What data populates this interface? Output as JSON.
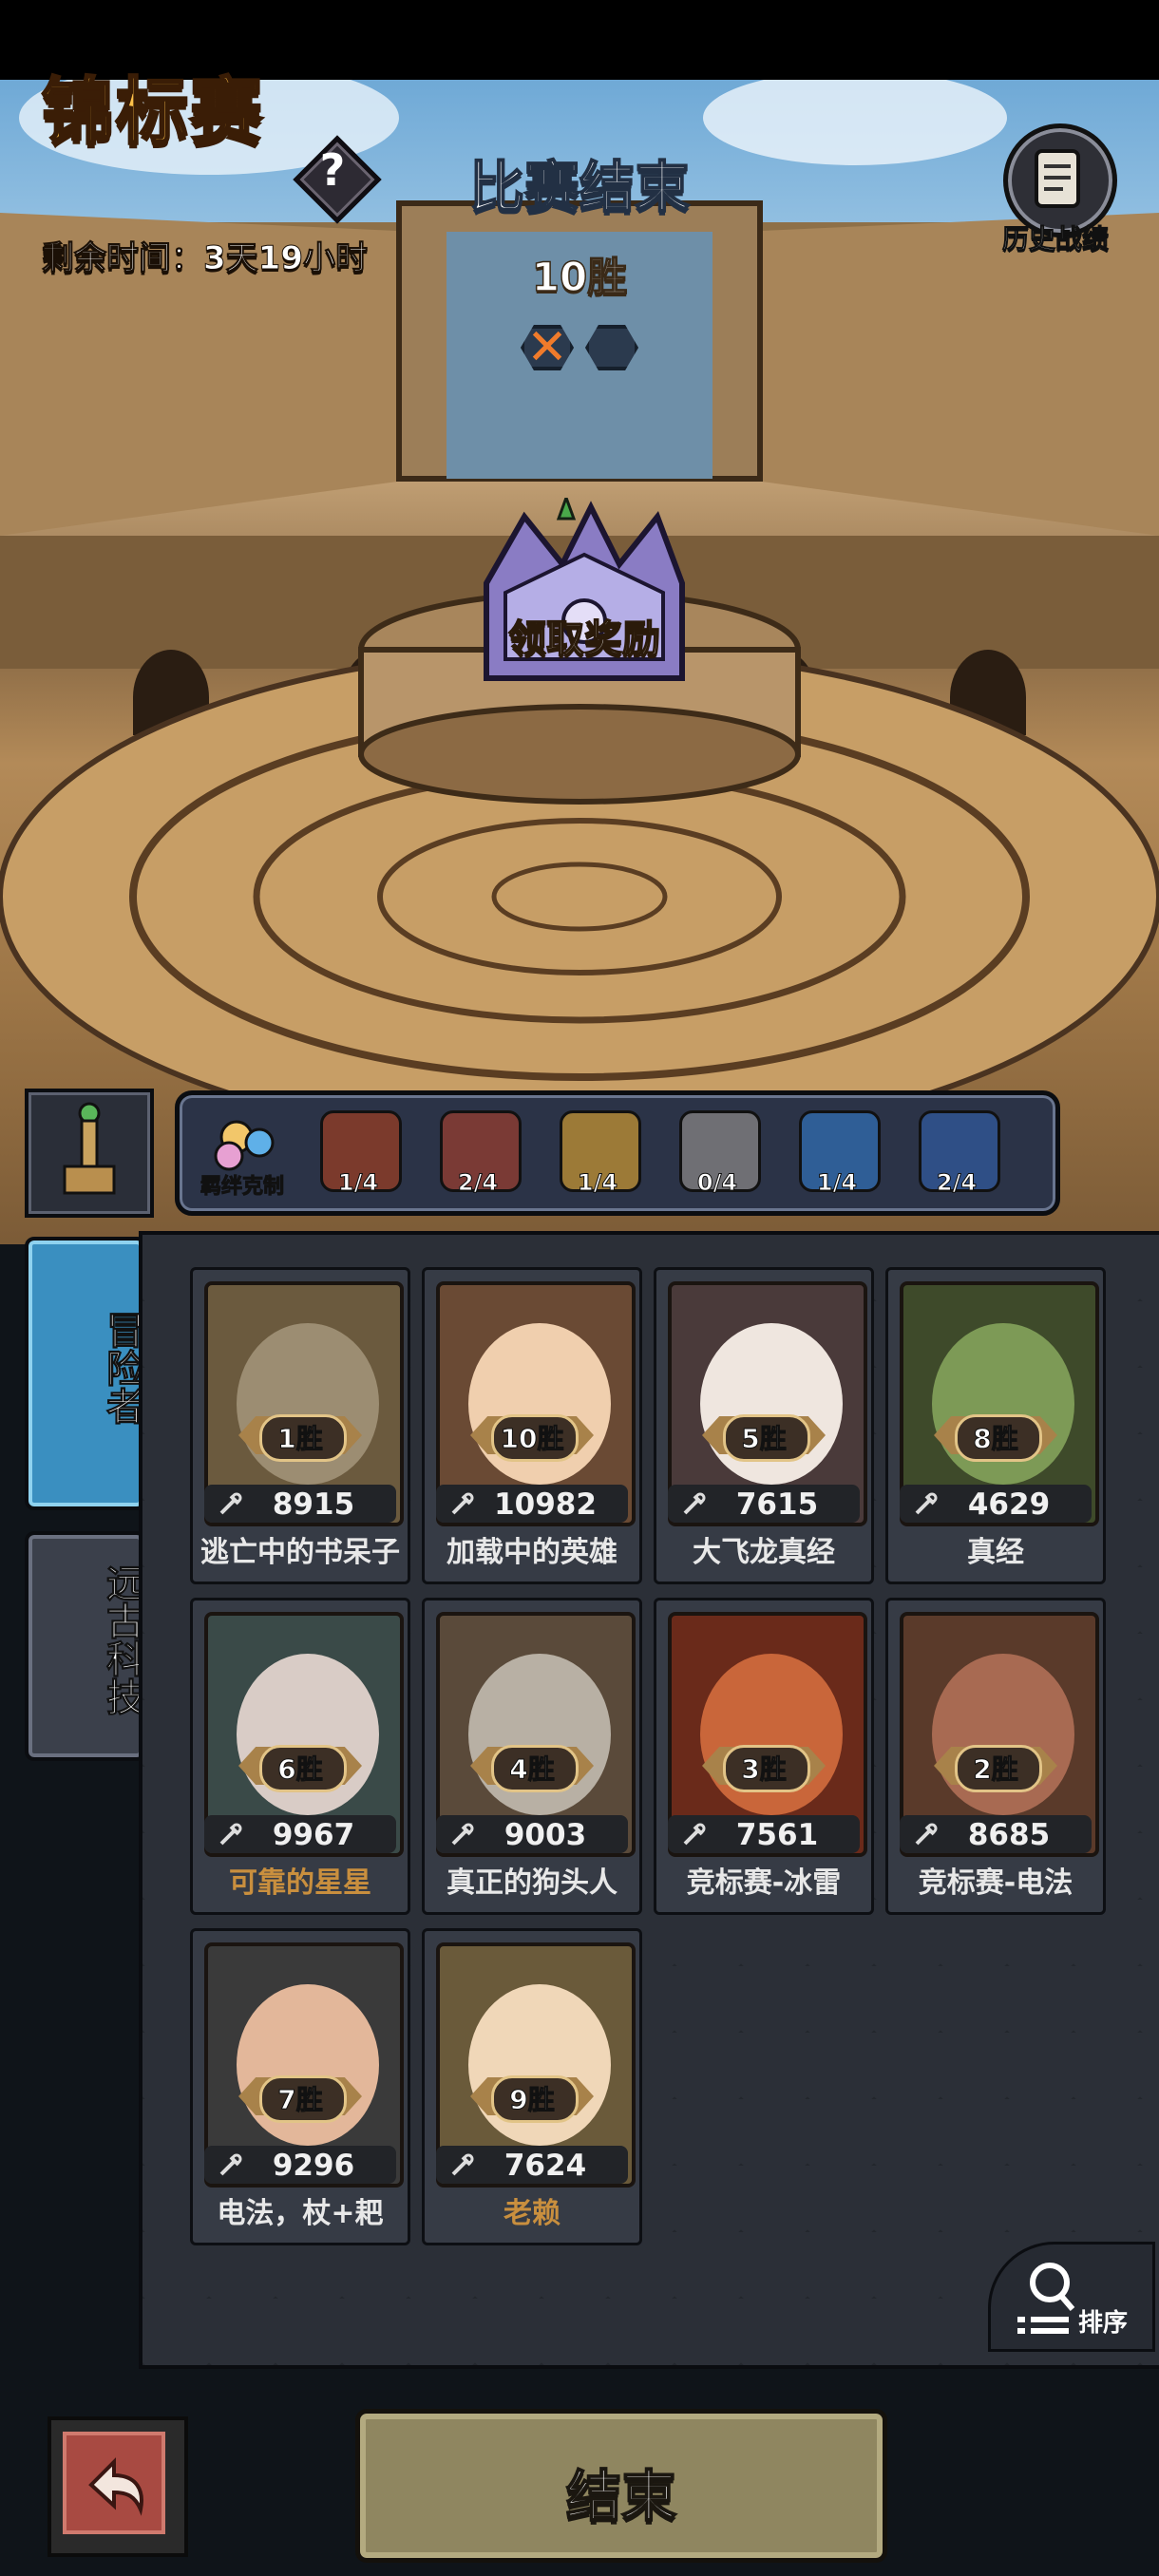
{
  "header": {
    "title": "锦标赛",
    "help_label": "?",
    "remaining_time": "剩余时间：3天19小时",
    "match_status": "比赛结束",
    "wins": "10胜",
    "history_label": "历史战绩"
  },
  "reward": {
    "claim_label": "领取奖励"
  },
  "bonds": {
    "counter_label": "羁绊克制",
    "items": [
      {
        "count": "1/4",
        "color": "#7b3a2c"
      },
      {
        "count": "2/4",
        "color": "#7a3a35"
      },
      {
        "count": "1/4",
        "color": "#9c7a37"
      },
      {
        "count": "0/4",
        "color": "#6f6f74"
      },
      {
        "count": "1/4",
        "color": "#2f5e96"
      },
      {
        "count": "2/4",
        "color": "#2f4f86"
      }
    ]
  },
  "side_tabs": {
    "adventurers": "冒险者",
    "ancient_tech": "远古科技"
  },
  "roster": [
    {
      "wins": "1胜",
      "power": "8915",
      "name": "逃亡中的书呆子",
      "highlight": false,
      "bg": "#6b5a3e",
      "skin": "#9c8d72"
    },
    {
      "wins": "10胜",
      "power": "10982",
      "name": "加载中的英雄",
      "highlight": false,
      "bg": "#6a4a34",
      "skin": "#f0cfae"
    },
    {
      "wins": "5胜",
      "power": "7615",
      "name": "大飞龙真经",
      "highlight": false,
      "bg": "#4a3a3a",
      "skin": "#efe6df"
    },
    {
      "wins": "8胜",
      "power": "4629",
      "name": "真经",
      "highlight": false,
      "bg": "#3e4a2a",
      "skin": "#7d9a56"
    },
    {
      "wins": "6胜",
      "power": "9967",
      "name": "可靠的星星",
      "highlight": true,
      "bg": "#3a4a48",
      "skin": "#d9ccc6"
    },
    {
      "wins": "4胜",
      "power": "9003",
      "name": "真正的狗头人",
      "highlight": false,
      "bg": "#5a4a3a",
      "skin": "#b8b0a4"
    },
    {
      "wins": "3胜",
      "power": "7561",
      "name": "竞标赛-冰雷",
      "highlight": false,
      "bg": "#6a2a1a",
      "skin": "#c9663a"
    },
    {
      "wins": "2胜",
      "power": "8685",
      "name": "竞标赛-电法",
      "highlight": false,
      "bg": "#5a3a2a",
      "skin": "#a86a52"
    },
    {
      "wins": "7胜",
      "power": "9296",
      "name": "电法，杖+耙",
      "highlight": false,
      "bg": "#3a3a3a",
      "skin": "#e3b79a"
    },
    {
      "wins": "9胜",
      "power": "7624",
      "name": "老赖",
      "highlight": true,
      "bg": "#6a5a3a",
      "skin": "#f0d7b8"
    }
  ],
  "sort_label": "排序",
  "end_button": "结束"
}
